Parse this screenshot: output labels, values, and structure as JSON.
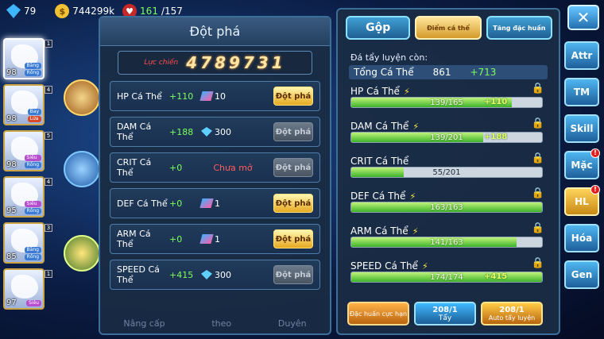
{
  "topbar": {
    "gems": "79",
    "coins": "744299k",
    "stamina_current": "161",
    "stamina_max": "/157"
  },
  "team": [
    {
      "level": "98",
      "tags": [
        "Băng",
        "Rồng"
      ],
      "slot": "1"
    },
    {
      "level": "98",
      "tags": [
        "Bay",
        "Lửa"
      ],
      "slot": "4"
    },
    {
      "level": "98",
      "tags": [
        "Siêu",
        "Rồng"
      ],
      "slot": "5"
    },
    {
      "level": "95",
      "tags": [
        "Siêu",
        "Rồng"
      ],
      "slot": "4"
    },
    {
      "level": "85",
      "tags": [
        "Băng",
        "Rồng"
      ],
      "slot": "3"
    },
    {
      "level": "97",
      "tags": [
        "Siêu"
      ],
      "slot": "1"
    }
  ],
  "breakthrough": {
    "title": "Đột phá",
    "power_label": "Lực chiến",
    "power_value": "4789731",
    "rows": [
      {
        "name": "HP Cá Thể",
        "bonus": "+110",
        "cost_type": "item",
        "cost": "10",
        "locked_text": "",
        "button": "Đột phá",
        "enabled": true
      },
      {
        "name": "DAM Cá Thể",
        "bonus": "+188",
        "cost_type": "gem",
        "cost": "300",
        "locked_text": "",
        "button": "Đột phá",
        "enabled": false
      },
      {
        "name": "CRIT Cá Thể",
        "bonus": "+0",
        "cost_type": "none",
        "cost": "",
        "locked_text": "Chưa mở",
        "button": "Đột phá",
        "enabled": false
      },
      {
        "name": "DEF Cá Thể",
        "bonus": "+0",
        "cost_type": "item",
        "cost": "1",
        "locked_text": "",
        "button": "Đột phá",
        "enabled": true
      },
      {
        "name": "ARM Cá Thể",
        "bonus": "+0",
        "cost_type": "item",
        "cost": "1",
        "locked_text": "",
        "button": "Đột phá",
        "enabled": true
      },
      {
        "name": "SPEED Cá Thể",
        "bonus": "+415",
        "cost_type": "gem",
        "cost": "300",
        "locked_text": "",
        "button": "Đột phá",
        "enabled": false
      }
    ],
    "bottom_tabs": [
      "Nâng cấp",
      "theo",
      "Duyên"
    ]
  },
  "training": {
    "tabs": [
      "Gộp",
      "Điểm cá thể",
      "Tăng đặc huấn"
    ],
    "remain_label": "Đá tẩy luyện còn:",
    "total_label": "Tổng Cá Thể",
    "total_value": "861",
    "total_bonus": "+713",
    "stats": [
      {
        "name": "HP Cá Thể",
        "bolt": true,
        "current": 139,
        "max": 165,
        "text": "139/165",
        "bonus": "+110"
      },
      {
        "name": "DAM Cá Thể",
        "bolt": true,
        "current": 139,
        "max": 201,
        "text": "139/201",
        "bonus": "+188"
      },
      {
        "name": "CRIT Cá Thể",
        "bolt": false,
        "current": 55,
        "max": 201,
        "text": "55/201",
        "bonus": ""
      },
      {
        "name": "DEF Cá Thể",
        "bolt": true,
        "current": 163,
        "max": 163,
        "text": "163/163",
        "bonus": ""
      },
      {
        "name": "ARM Cá Thể",
        "bolt": true,
        "current": 141,
        "max": 163,
        "text": "141/163",
        "bonus": ""
      },
      {
        "name": "SPEED Cá Thể",
        "bolt": true,
        "current": 174,
        "max": 174,
        "text": "174/174",
        "bonus": "+415"
      }
    ],
    "buttons": {
      "special_label": "Đặc huấn cực hạn",
      "wash_count": "208/1",
      "wash_label": "Tẩy",
      "auto_count": "208/1",
      "auto_label": "Auto tẩy luyện"
    }
  },
  "nav": [
    {
      "label": "Attr",
      "badge": false,
      "active": false
    },
    {
      "label": "TM",
      "badge": false,
      "active": false
    },
    {
      "label": "Skill",
      "badge": false,
      "active": false
    },
    {
      "label": "Mặc",
      "badge": true,
      "active": false
    },
    {
      "label": "HL",
      "badge": true,
      "active": true
    },
    {
      "label": "Hóa",
      "badge": false,
      "active": false
    },
    {
      "label": "Gen",
      "badge": false,
      "active": false
    }
  ],
  "close_symbol": "✕",
  "badge_symbol": "!"
}
